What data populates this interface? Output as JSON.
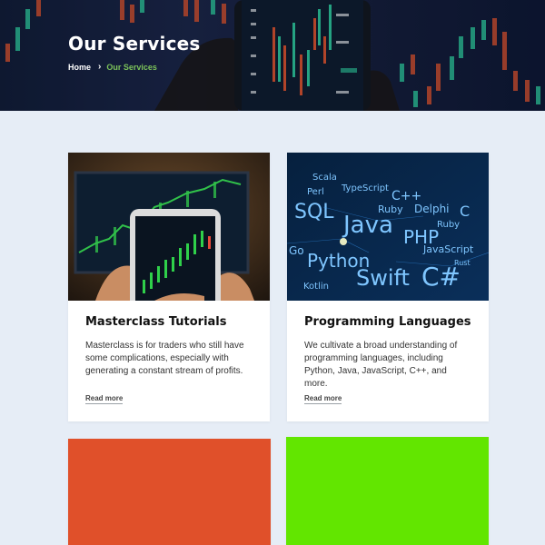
{
  "hero": {
    "title": "Our Services",
    "breadcrumb": {
      "home": "Home",
      "separator": "›",
      "current": "Our Services"
    },
    "accent_color": "#7cc35a"
  },
  "cards": [
    {
      "title": "Masterclass Tutorials",
      "text": "Masterclass is for traders who still have some complications, especially with generating a constant stream of profits.",
      "link": "Read more",
      "image": "trading-app-on-phone-image"
    },
    {
      "title": "Programming Languages",
      "text": "We cultivate a broad understanding of programming languages, including Python, Java, JavaScript, C++, and more.",
      "link": "Read more",
      "image": "programming-languages-code-image",
      "image_words": [
        "Scala",
        "TypeScript",
        "Perl",
        "C++",
        "SQL",
        "Java",
        "Ruby",
        "Delphi",
        "Ruby",
        "C",
        "Go",
        "PHP",
        "Python",
        "JavaScript",
        "Swift",
        "C#",
        "Kotlin",
        "Rust"
      ]
    },
    {
      "color": "#e0502a"
    },
    {
      "color": "#62e600"
    }
  ]
}
